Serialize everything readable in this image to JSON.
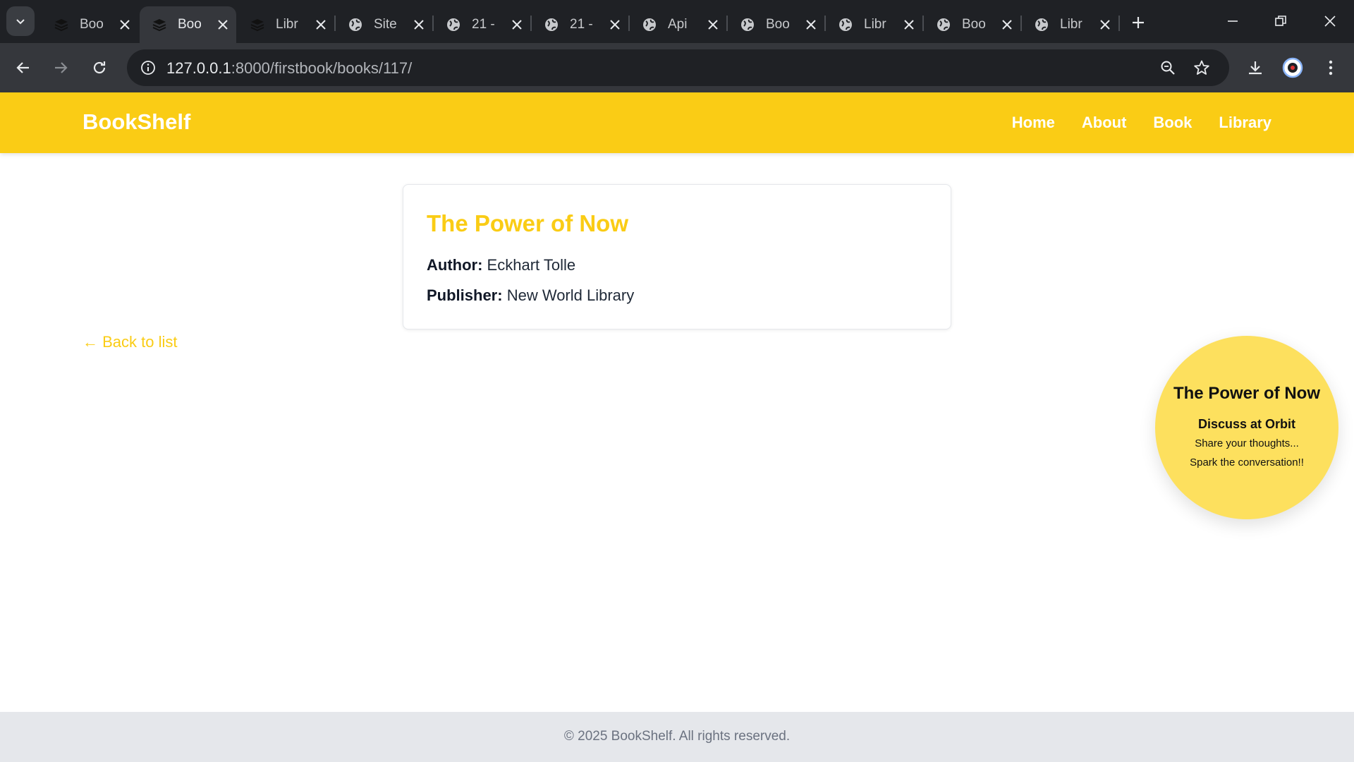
{
  "browser": {
    "tabs": [
      {
        "title": "Boo",
        "icon": "books-icon"
      },
      {
        "title": "Boo",
        "icon": "books-icon",
        "active": true
      },
      {
        "title": "Libr",
        "icon": "books-icon"
      },
      {
        "title": "Site",
        "icon": "globe-icon"
      },
      {
        "title": "21 -",
        "icon": "globe-icon"
      },
      {
        "title": "21 -",
        "icon": "globe-icon"
      },
      {
        "title": "Api",
        "icon": "globe-icon"
      },
      {
        "title": "Boo",
        "icon": "globe-icon"
      },
      {
        "title": "Libr",
        "icon": "globe-icon"
      },
      {
        "title": "Boo",
        "icon": "globe-icon"
      },
      {
        "title": "Libr",
        "icon": "globe-icon"
      }
    ],
    "url_host": "127.0.0.1",
    "url_path": ":8000/firstbook/books/117/"
  },
  "site": {
    "brand": "BookShelf",
    "nav": [
      "Home",
      "About",
      "Book",
      "Library"
    ],
    "accent_color": "#facc15"
  },
  "book": {
    "title": "The Power of Now",
    "author_label": "Author:",
    "author": "Eckhart Tolle",
    "publisher_label": "Publisher:",
    "publisher": "New World Library"
  },
  "back_link": "← Back to list",
  "orbit": {
    "title": "The Power of Now",
    "subtitle": "Discuss at Orbit",
    "line1": "Share your thoughts...",
    "line2": "Spark the conversation!!"
  },
  "footer": {
    "copyright": "© 2025 BookShelf. All rights reserved."
  }
}
